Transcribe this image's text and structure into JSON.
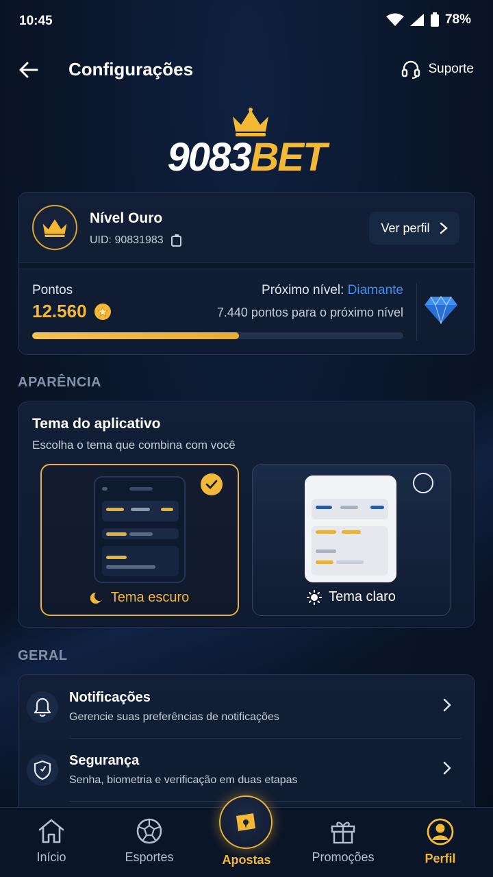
{
  "status_bar": {
    "time": "10:45",
    "battery": "78%"
  },
  "header": {
    "title": "Configurações",
    "support_label": "Suporte"
  },
  "logo": {
    "number": "9083",
    "brand": "BET"
  },
  "profile": {
    "level_name": "Nível Ouro",
    "uid": "UID: 90831983",
    "view_profile_label": "Ver perfil",
    "points_label": "Pontos",
    "points_value": "12.560",
    "next_level_prefix": "Próximo nível: ",
    "next_level_name": "Diamante",
    "next_level_desc": "7.440 pontos para o próximo nível",
    "progress_fraction": 0.558
  },
  "appearance": {
    "section_label": "APARÊNCIA",
    "title": "Tema do aplicativo",
    "subtitle": "Escolha o tema que combina com você",
    "dark_label": "Tema escuro",
    "light_label": "Tema claro",
    "selected": "dark"
  },
  "general": {
    "section_label": "GERAL",
    "items": [
      {
        "title": "Notificações",
        "subtitle": "Gerencie suas preferências de notificações",
        "icon": "bell-icon"
      },
      {
        "title": "Segurança",
        "subtitle": "Senha, biometria e verificação em duas etapas",
        "icon": "shield-icon"
      }
    ]
  },
  "bottom_nav": {
    "items": [
      {
        "label": "Início",
        "icon": "home-icon"
      },
      {
        "label": "Esportes",
        "icon": "soccer-ball-icon"
      },
      {
        "label": "Apostas",
        "icon": "ticket-icon"
      },
      {
        "label": "Promoções",
        "icon": "gift-icon"
      },
      {
        "label": "Perfil",
        "icon": "user-icon"
      }
    ],
    "active": "Perfil"
  },
  "colors": {
    "accent": "#f3b935",
    "link": "#3d8ef0",
    "background": "#0a1426"
  }
}
